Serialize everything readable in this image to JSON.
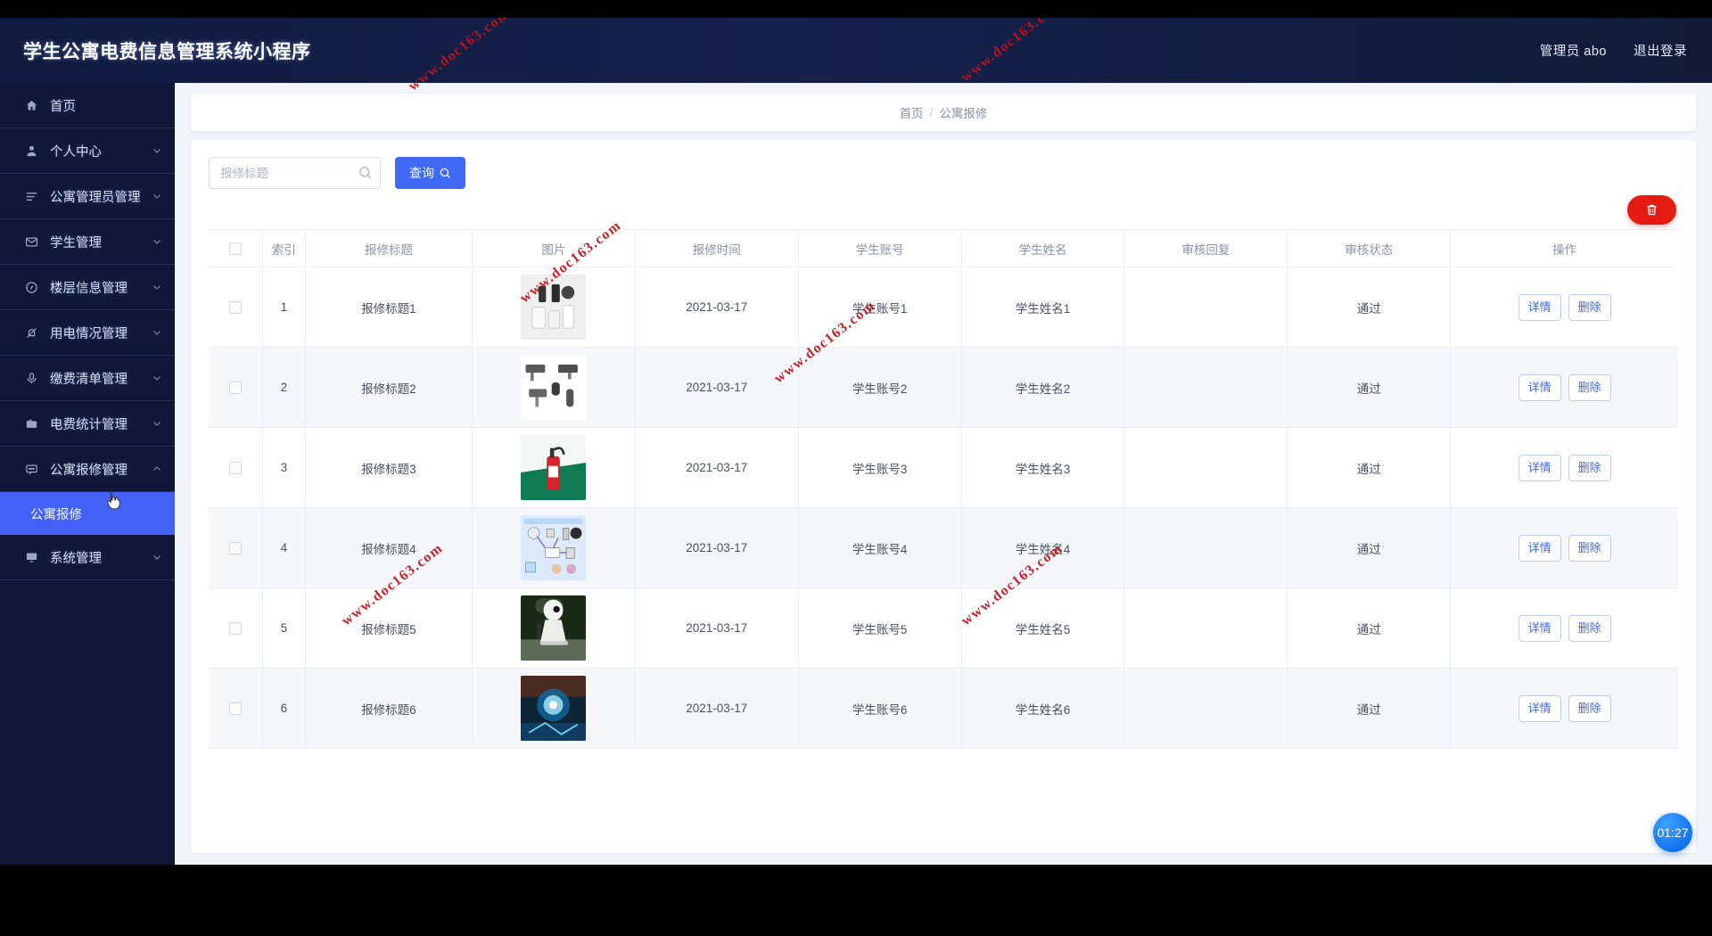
{
  "header": {
    "brand": "学生公寓电费信息管理系统小程序",
    "user": "管理员 abo",
    "logout": "退出登录"
  },
  "sidebar": {
    "items": [
      {
        "label": "首页",
        "icon": "home-icon",
        "chevron": ""
      },
      {
        "label": "个人中心",
        "icon": "user-icon",
        "chevron": "chevron-down-icon"
      },
      {
        "label": "公寓管理员管理",
        "icon": "list-icon",
        "chevron": "chevron-down-icon"
      },
      {
        "label": "学生管理",
        "icon": "mail-icon",
        "chevron": "chevron-down-icon"
      },
      {
        "label": "楼层信息管理",
        "icon": "clock-icon",
        "chevron": "chevron-down-icon"
      },
      {
        "label": "用电情况管理",
        "icon": "bell-off-icon",
        "chevron": "chevron-down-icon"
      },
      {
        "label": "缴费清单管理",
        "icon": "mic-icon",
        "chevron": "chevron-down-icon"
      },
      {
        "label": "电费统计管理",
        "icon": "wallet-icon",
        "chevron": "chevron-down-icon"
      },
      {
        "label": "公寓报修管理",
        "icon": "message-icon",
        "chevron": "chevron-up-icon"
      }
    ],
    "active_sub": "公寓报修",
    "last_item": {
      "label": "系统管理",
      "icon": "monitor-icon",
      "chevron": "chevron-down-icon"
    }
  },
  "breadcrumb": {
    "home": "首页",
    "sep": "/",
    "current": "公寓报修"
  },
  "toolbar": {
    "search_placeholder": "报修标题",
    "search_value": "",
    "query_label": "查询",
    "search_icon": "search-icon",
    "trash_icon": "trash-icon"
  },
  "table": {
    "columns": [
      "索引",
      "报修标题",
      "图片",
      "报修时间",
      "学生账号",
      "学生姓名",
      "审核回复",
      "审核状态",
      "操作"
    ],
    "actions": {
      "detail": "详情",
      "delete": "删除"
    },
    "rows": [
      {
        "index": "1",
        "title": "报修标题1",
        "time": "2021-03-17",
        "account": "学生账号1",
        "name": "学生姓名1",
        "reply": "",
        "state": "通过"
      },
      {
        "index": "2",
        "title": "报修标题2",
        "time": "2021-03-17",
        "account": "学生账号2",
        "name": "学生姓名2",
        "reply": "",
        "state": "通过"
      },
      {
        "index": "3",
        "title": "报修标题3",
        "time": "2021-03-17",
        "account": "学生账号3",
        "name": "学生姓名3",
        "reply": "",
        "state": "通过"
      },
      {
        "index": "4",
        "title": "报修标题4",
        "time": "2021-03-17",
        "account": "学生账号4",
        "name": "学生姓名4",
        "reply": "",
        "state": "通过"
      },
      {
        "index": "5",
        "title": "报修标题5",
        "time": "2021-03-17",
        "account": "学生账号5",
        "name": "学生姓名5",
        "reply": "",
        "state": "通过"
      },
      {
        "index": "6",
        "title": "报修标题6",
        "time": "2021-03-17",
        "account": "学生账号6",
        "name": "学生姓名6",
        "reply": "",
        "state": "通过"
      }
    ]
  },
  "timer": {
    "value": "01:27"
  },
  "watermark": {
    "text": "www.doc163.com",
    "color": "#c2121a"
  },
  "colors": {
    "accent": "#4069f5",
    "sidebar": "#0f1838",
    "danger": "#e41b13",
    "header_bg": "#101a3e"
  }
}
